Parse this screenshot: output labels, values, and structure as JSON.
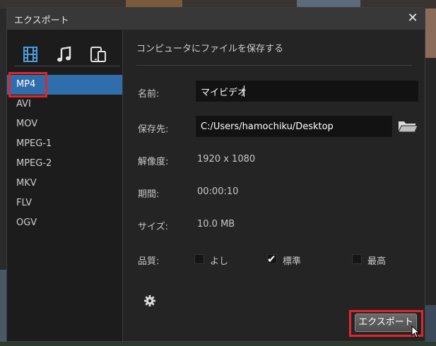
{
  "dialog": {
    "title": "エクスポート",
    "close_glyph": "✕"
  },
  "type_tabs": [
    {
      "icon": "film-icon",
      "selected": true
    },
    {
      "icon": "music-note-icon",
      "selected": false
    },
    {
      "icon": "devices-icon",
      "selected": false
    }
  ],
  "formats": [
    "MP4",
    "AVI",
    "MOV",
    "MPEG-1",
    "MPEG-2",
    "MKV",
    "FLV",
    "OGV"
  ],
  "selected_format": "MP4",
  "main": {
    "section_title": "コンピュータにファイルを保存する",
    "name_label": "名前:",
    "name_value": "マイビデオ",
    "dest_label": "保存先:",
    "dest_value": "C:/Users/hamochiku/Desktop",
    "resolution_label": "解像度:",
    "resolution_value": "1920 x 1080",
    "duration_label": "期間:",
    "duration_value": "00:00:10",
    "size_label": "サイズ:",
    "size_value": "10.0 MB",
    "quality_label": "品質:",
    "quality_options": [
      {
        "label": "よし",
        "checked": false
      },
      {
        "label": "標準",
        "checked": true
      },
      {
        "label": "最高",
        "checked": false
      }
    ],
    "export_button": "エクスポート"
  },
  "colors": {
    "selected_row": "#2f6eab",
    "highlight_box": "#e0262b",
    "dialog_bg": "#242424",
    "titlebar_bg": "#383838"
  }
}
